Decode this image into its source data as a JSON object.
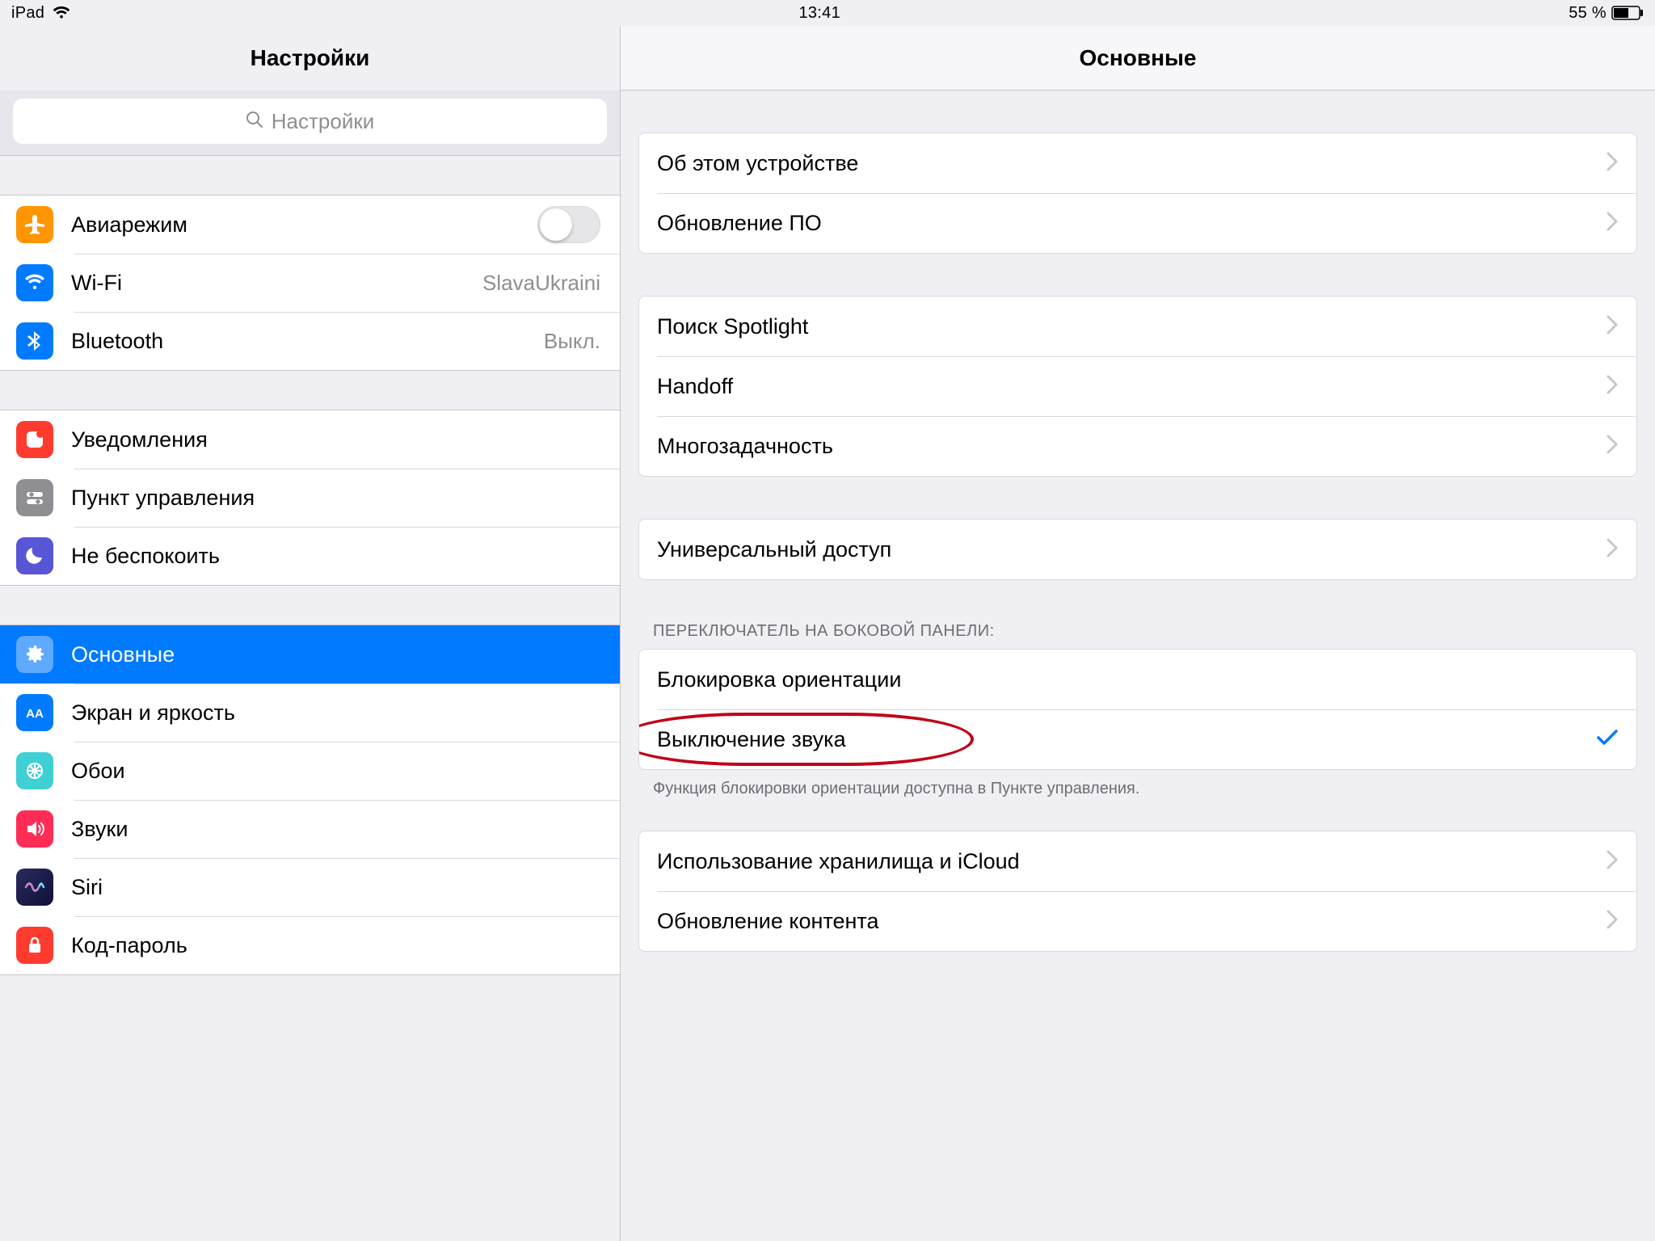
{
  "status_bar": {
    "device": "iPad",
    "time": "13:41",
    "battery_text": "55 %"
  },
  "sidebar": {
    "title": "Настройки",
    "search_placeholder": "Настройки",
    "groups": [
      {
        "items": [
          {
            "key": "airplane",
            "label": "Авиарежим",
            "control": "toggle"
          },
          {
            "key": "wifi",
            "label": "Wi-Fi",
            "value": "SlavaUkraini"
          },
          {
            "key": "bluetooth",
            "label": "Bluetooth",
            "value": "Выкл."
          }
        ]
      },
      {
        "items": [
          {
            "key": "notifications",
            "label": "Уведомления"
          },
          {
            "key": "control-center",
            "label": "Пункт управления"
          },
          {
            "key": "do-not-disturb",
            "label": "Не беспокоить"
          }
        ]
      },
      {
        "items": [
          {
            "key": "general",
            "label": "Основные",
            "selected": true
          },
          {
            "key": "display",
            "label": "Экран и яркость"
          },
          {
            "key": "wallpaper",
            "label": "Обои"
          },
          {
            "key": "sounds",
            "label": "Звуки"
          },
          {
            "key": "siri",
            "label": "Siri"
          },
          {
            "key": "passcode",
            "label": "Код-пароль"
          }
        ]
      }
    ]
  },
  "content": {
    "title": "Основные",
    "groups": [
      {
        "items": [
          {
            "key": "about",
            "label": "Об этом устройстве"
          },
          {
            "key": "software-update",
            "label": "Обновление ПО"
          }
        ]
      },
      {
        "items": [
          {
            "key": "spotlight",
            "label": "Поиск Spotlight"
          },
          {
            "key": "handoff",
            "label": "Handoff"
          },
          {
            "key": "multitasking",
            "label": "Многозадачность"
          }
        ]
      },
      {
        "items": [
          {
            "key": "accessibility",
            "label": "Универсальный доступ"
          }
        ]
      },
      {
        "header": "ПЕРЕКЛЮЧАТЕЛЬ НА БОКОВОЙ ПАНЕЛИ:",
        "items": [
          {
            "key": "lock-rotation",
            "label": "Блокировка ориентации",
            "type": "radio"
          },
          {
            "key": "mute",
            "label": "Выключение звука",
            "type": "radio",
            "checked": true,
            "annotated": true
          }
        ],
        "footer": "Функция блокировки ориентации доступна в Пункте управления."
      },
      {
        "items": [
          {
            "key": "storage",
            "label": "Использование хранилища и iCloud"
          },
          {
            "key": "refresh",
            "label": "Обновление контента"
          }
        ]
      }
    ]
  },
  "icons": {
    "airplane_bg": "#ff9500",
    "wifi_bg": "#007aff",
    "bluetooth_bg": "#007aff",
    "notifications_bg": "#ff3b30",
    "control-center_bg": "#8e8e93",
    "do-not-disturb_bg": "#5856d6",
    "general_bg": "#8e8e93",
    "general_selected_bg": "#5fa9ff",
    "display_bg": "#007aff",
    "wallpaper_bg": "#3fd0d4",
    "sounds_bg": "#ff2d55",
    "siri_bg": "#1b1b3a",
    "passcode_bg": "#ff3b30"
  }
}
